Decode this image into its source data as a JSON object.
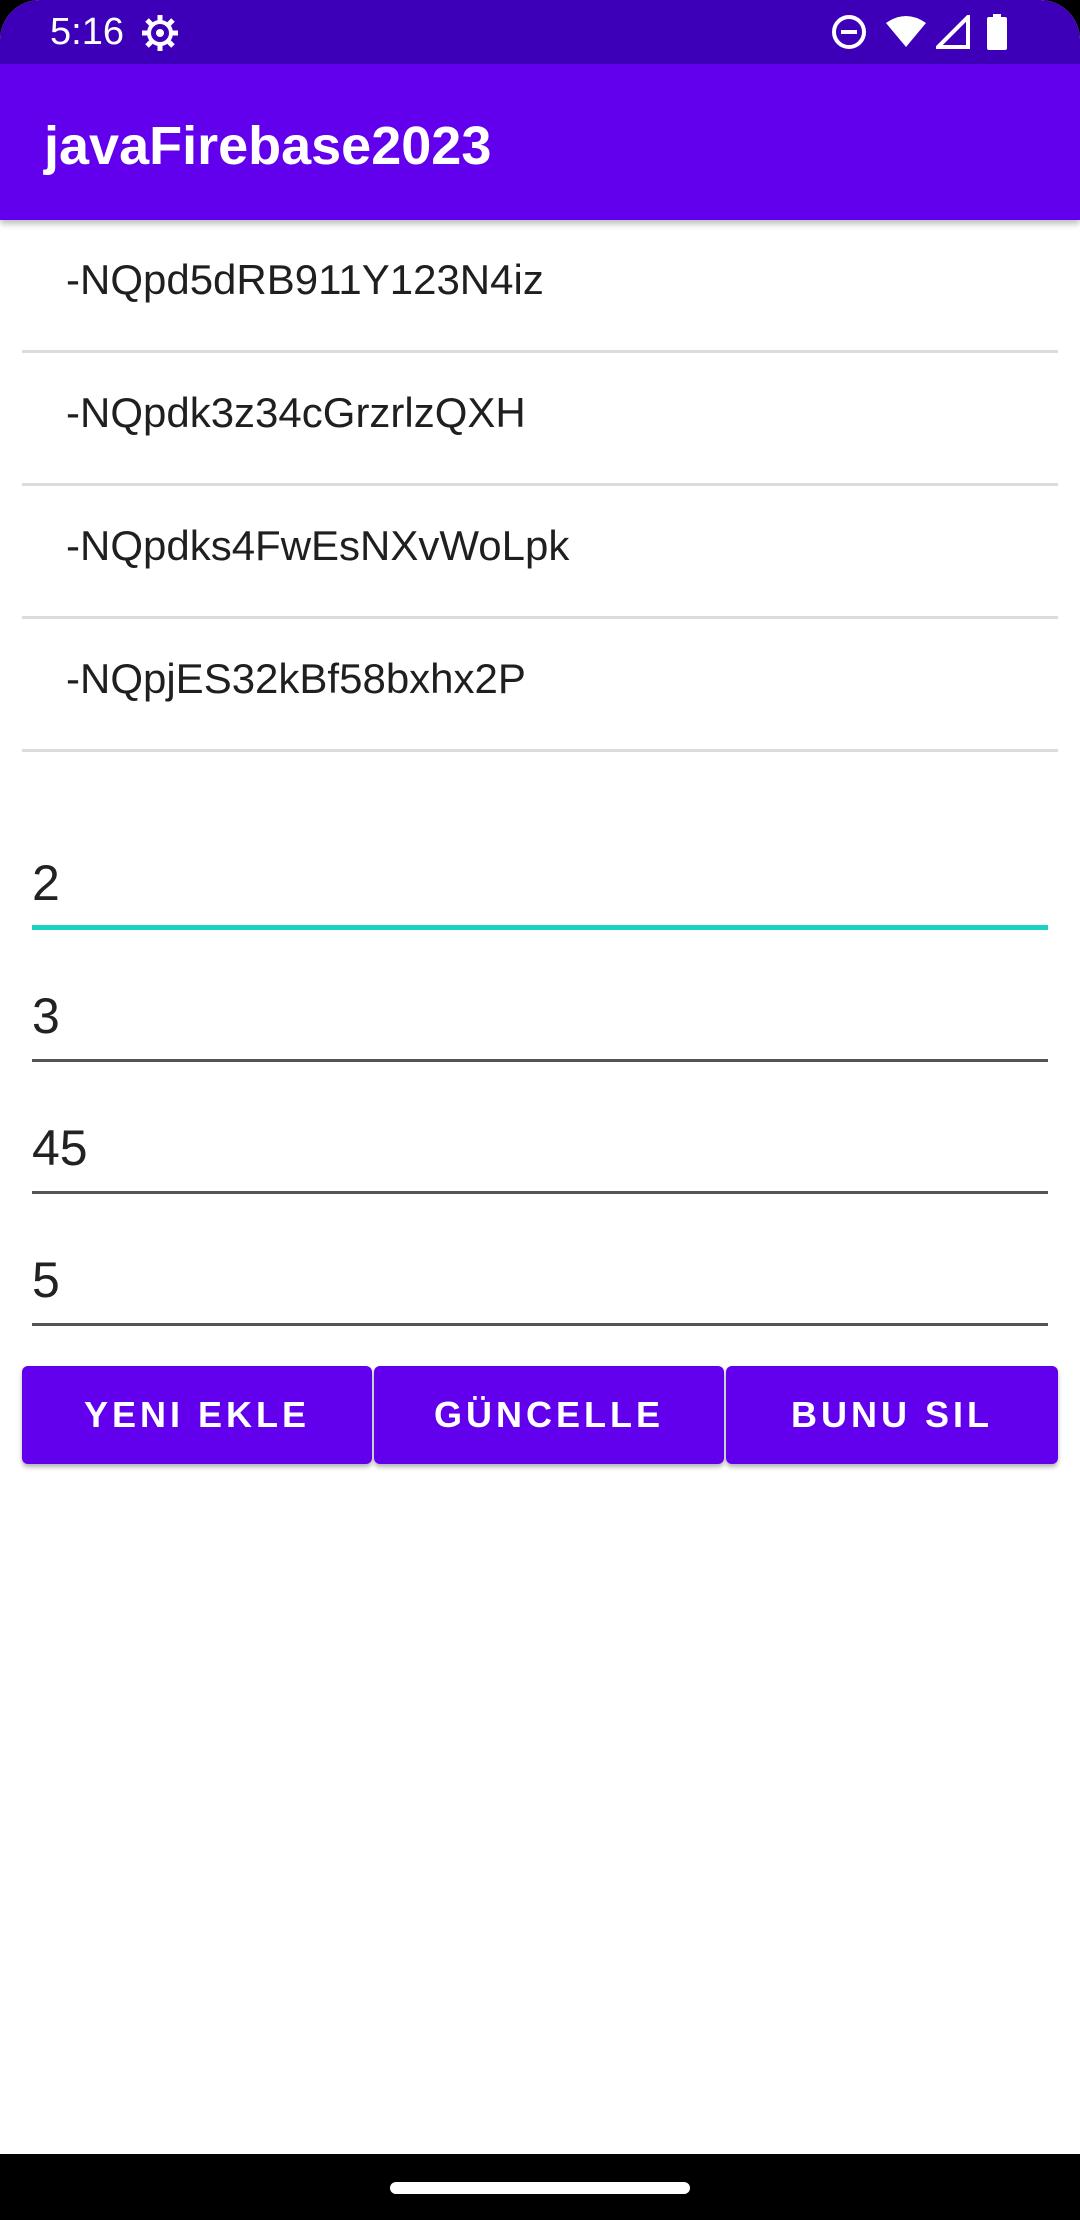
{
  "status_bar": {
    "time": "5:16",
    "icons": [
      "settings-gear-icon",
      "do-not-disturb-icon",
      "wifi-icon",
      "cell-signal-icon",
      "battery-icon"
    ]
  },
  "app_bar": {
    "title": "javaFirebase2023"
  },
  "key_list": {
    "items": [
      "-NQpd5dRB911Y123N4iz",
      "-NQpdk3z34cGrzrlzQXH",
      "-NQpdks4FwEsNXvWoLpk",
      "-NQpjES32kBf58bxhx2P"
    ]
  },
  "fields": {
    "values": [
      "2",
      "3",
      "45",
      "5"
    ],
    "focused_index": 0,
    "focus_color": "#18d3c4"
  },
  "buttons": {
    "add_label": "YENI EKLE",
    "update_label": "GÜNCELLE",
    "delete_label": "BUNU SIL"
  },
  "colors": {
    "status_bar": "#3d00b8",
    "primary": "#6200ee",
    "accent": "#18d3c4"
  }
}
